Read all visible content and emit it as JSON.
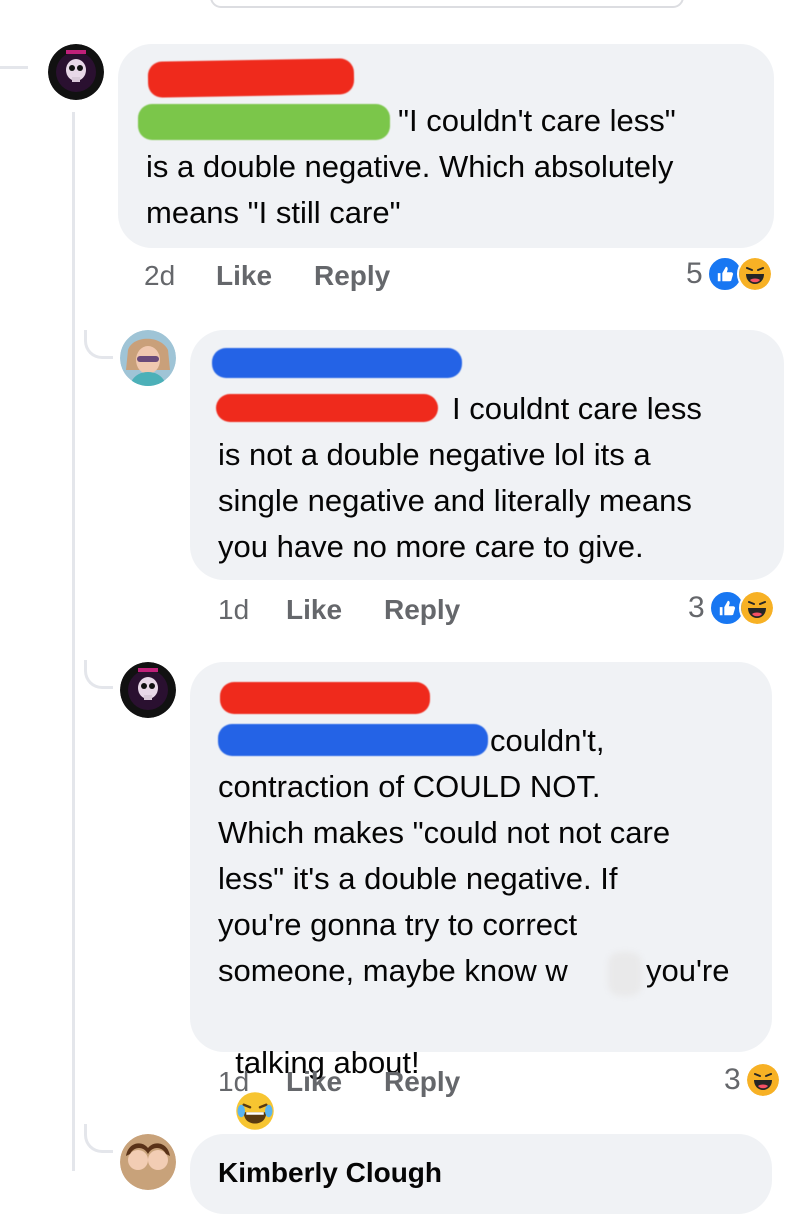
{
  "comments": [
    {
      "text_lines": [
        "\"I couldn't care less\"",
        "is a double negative. Which absolutely",
        "means \"I still care\""
      ],
      "time": "2d",
      "like_label": "Like",
      "reply_label": "Reply",
      "reaction_count": "5",
      "reactions": [
        "like-icon",
        "haha-icon"
      ]
    },
    {
      "text_lines": [
        "I couldnt care less",
        "is not a double negative lol its a",
        "single negative and literally means",
        "you have no more care to give."
      ],
      "time": "1d",
      "like_label": "Like",
      "reply_label": "Reply",
      "reaction_count": "3",
      "reactions": [
        "like-icon",
        "haha-icon"
      ]
    },
    {
      "text_lines": [
        "couldn't,",
        "contraction of COULD NOT.",
        "Which makes \"could not not care",
        "less\" it's a double negative. If",
        "you're gonna try to correct",
        "someone, maybe know w",
        "you're",
        "talking about!"
      ],
      "time": "1d",
      "like_label": "Like",
      "reply_label": "Reply",
      "reaction_count": "3",
      "reactions": [
        "haha-icon"
      ]
    }
  ],
  "next_comment": {
    "partial_name": "Kimberly Clough"
  },
  "colors": {
    "bubble": "#f0f2f5",
    "meta_text": "#65676b",
    "like_blue": "#1877f2",
    "redact_red": "#ef2a1c",
    "redact_green": "#7bc64a",
    "redact_blue": "#2463e6"
  }
}
